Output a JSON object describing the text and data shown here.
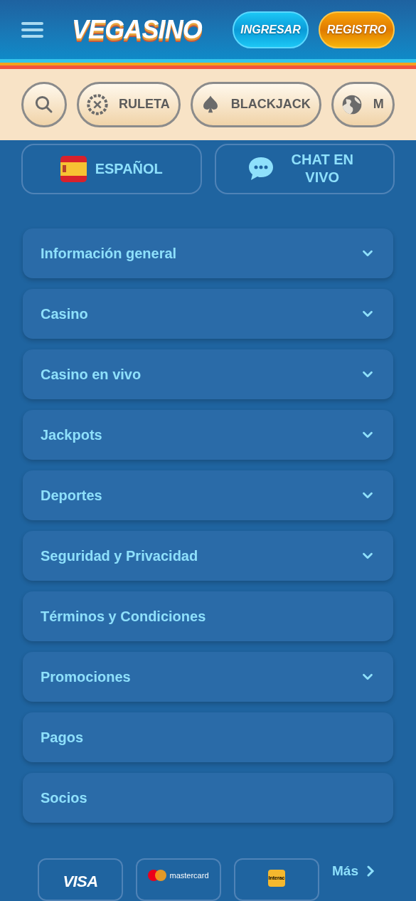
{
  "header": {
    "logo": "VEGASINO",
    "buttons": [
      {
        "label": "INGRESAR",
        "kind": "login"
      },
      {
        "label": "REGISTRO",
        "kind": "register"
      }
    ]
  },
  "categories": [
    {
      "kind": "search"
    },
    {
      "kind": "roulette",
      "label": "RULETA"
    },
    {
      "kind": "spade",
      "label": "BLACKJACK"
    },
    {
      "kind": "globe",
      "label": "M"
    }
  ],
  "quick_actions": [
    {
      "kind": "language",
      "label": "ESPAÑOL"
    },
    {
      "kind": "chat",
      "label": "CHAT EN VIVO"
    }
  ],
  "menu": [
    {
      "label": "Información general",
      "kind": "dropdown",
      "expanded": false
    },
    {
      "label": "Casino",
      "kind": "dropdown",
      "expanded": false
    },
    {
      "label": "Casino en vivo",
      "kind": "dropdown",
      "expanded": false
    },
    {
      "label": "Jackpots",
      "kind": "dropdown",
      "expanded": false
    },
    {
      "label": "Deportes",
      "kind": "dropdown",
      "expanded": false
    },
    {
      "label": "Seguridad y Privacidad",
      "kind": "dropdown",
      "expanded": false
    },
    {
      "label": "Términos y Condiciones",
      "kind": "link"
    },
    {
      "label": "Promociones",
      "kind": "dropdown",
      "expanded": false
    },
    {
      "label": "Pagos",
      "kind": "link"
    },
    {
      "label": "Socios",
      "kind": "link"
    }
  ],
  "payments": {
    "methods": [
      {
        "kind": "visa",
        "label": "VISA"
      },
      {
        "kind": "mastercard",
        "label": "mastercard"
      },
      {
        "kind": "interac",
        "label": "Interac"
      }
    ],
    "more": "Más"
  }
}
